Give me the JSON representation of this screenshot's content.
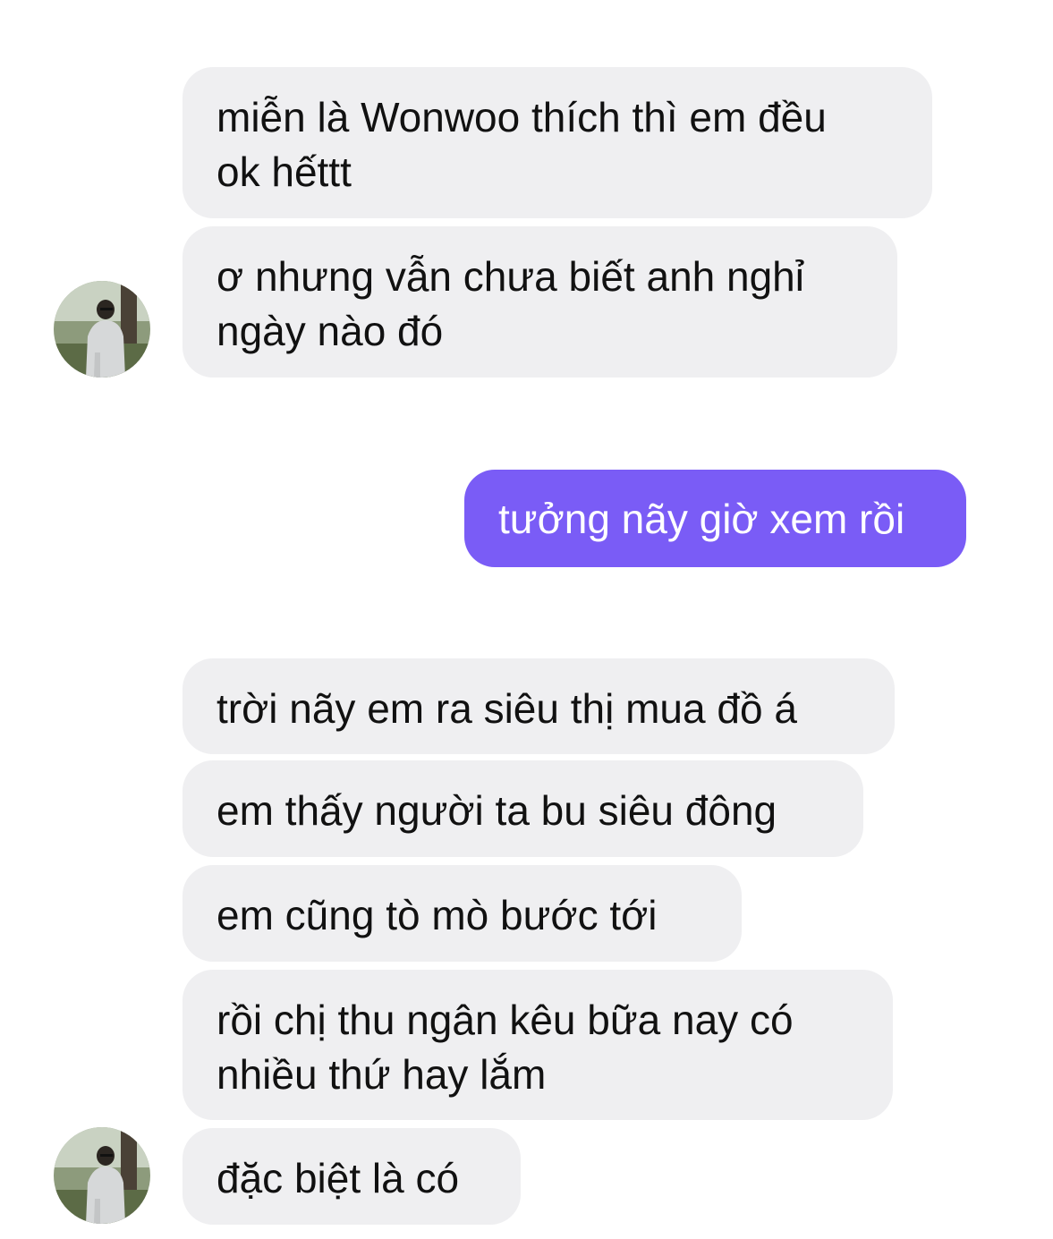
{
  "conversation": {
    "messages": [
      {
        "direction": "in",
        "text": "miễn là Wonwoo thích thì em đều\nok hếttt"
      },
      {
        "direction": "in",
        "text": "ơ nhưng vẫn chưa biết anh nghỉ\nngày nào đó"
      },
      {
        "direction": "out",
        "text": "tưởng nãy giờ xem rồi"
      },
      {
        "direction": "in",
        "text": "trời nãy em ra siêu thị mua đồ á"
      },
      {
        "direction": "in",
        "text": "em thấy người ta bu siêu đông"
      },
      {
        "direction": "in",
        "text": "em cũng tò mò bước tới"
      },
      {
        "direction": "in",
        "text": "rồi chị thu ngân kêu bữa nay có\nnhiều thứ hay lắm"
      },
      {
        "direction": "in",
        "text": "đặc biệt là có"
      }
    ]
  },
  "avatars": {
    "icon": "contact-avatar-photo"
  },
  "colors": {
    "incoming_bubble": "#efeff1",
    "outgoing_bubble": "#7a5cf6",
    "incoming_text": "#111111",
    "outgoing_text": "#ffffff",
    "background": "#ffffff"
  }
}
